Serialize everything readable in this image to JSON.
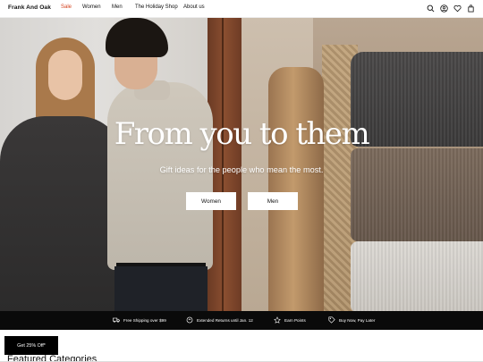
{
  "header": {
    "brand": "Frank And Oak",
    "nav": [
      {
        "label": "Sale"
      },
      {
        "label": "Women"
      },
      {
        "label": "Men"
      },
      {
        "label": "The Holiday Shop"
      },
      {
        "label": "About us"
      }
    ],
    "icons": [
      "search-icon",
      "account-icon",
      "wishlist-icon",
      "cart-icon"
    ]
  },
  "hero": {
    "title": "From you to them",
    "subtitle": "Gift ideas for the people who mean the most.",
    "buttons": [
      {
        "label": "Women"
      },
      {
        "label": "Men"
      }
    ]
  },
  "promo": {
    "items": [
      {
        "icon": "truck-icon",
        "label": "Free Shipping over $99"
      },
      {
        "icon": "return-icon",
        "label": "Extended Returns until Jan. 12"
      },
      {
        "icon": "points-icon",
        "label": "Earn Points"
      },
      {
        "icon": "tag-icon",
        "label": "Buy Now, Pay Later"
      }
    ]
  },
  "cta_popup": {
    "label": "Get 25% Off*"
  },
  "featured": {
    "title": "Featured Categories"
  },
  "colors": {
    "sale": "#d4421f",
    "promo_bg": "#0a0a0a",
    "button_bg": "#ffffff"
  }
}
